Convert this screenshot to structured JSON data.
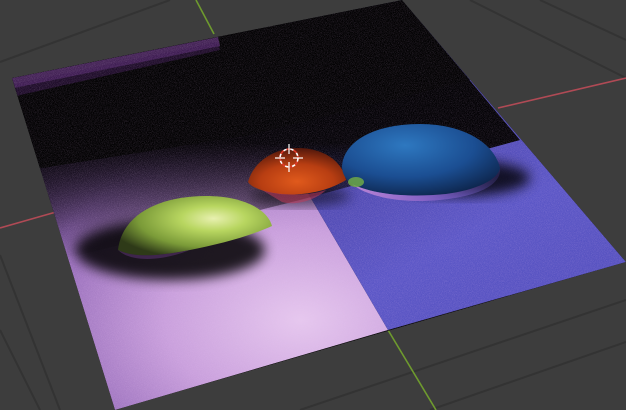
{
  "app": {
    "editor": "3D Viewport",
    "shading_mode": "rendered"
  },
  "viewport": {
    "background_color": "#3d3d3d",
    "grid_line_color": "#333333",
    "x_axis_color": "#b04a55",
    "y_axis_color": "#6e9a2e"
  },
  "scene": {
    "plane": {
      "left_region_color": "#b58ad8",
      "right_region_color": "#5a58c4",
      "shadow_color": "#050208"
    },
    "spheres": [
      {
        "name": "green-sphere",
        "color": "#a8cc55"
      },
      {
        "name": "red-sphere",
        "color": "#c84818"
      },
      {
        "name": "blue-sphere",
        "color": "#1e5aa0"
      }
    ],
    "cursor": {
      "icon": "3d-cursor-icon",
      "colors": [
        "#ffffff",
        "#e03a2a"
      ]
    }
  }
}
